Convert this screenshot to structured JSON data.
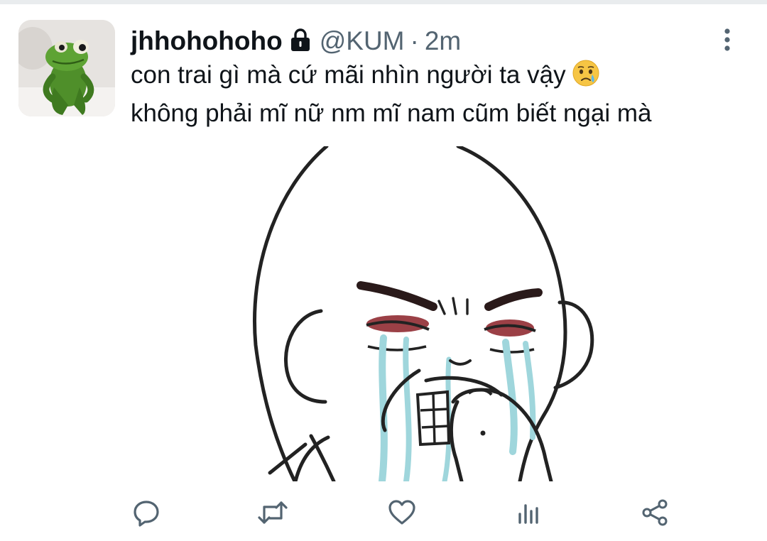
{
  "tweet": {
    "display_name": "jhhohohoho",
    "handle": "@KUM",
    "separator": "·",
    "timestamp": "2m",
    "protected_icon": "lock-icon",
    "text_line_1": "con trai gì mà cứ mãi nhìn người ta vậy",
    "text_line_1_emoji": "crying-face-emoji",
    "text_line_2": "không phải mĩ nữ nm mĩ nam cũm biết ngại mà",
    "avatar": "kermit-frog-avatar",
    "media": "crying-meme-face-image"
  },
  "actions": [
    {
      "icon": "reply-icon"
    },
    {
      "icon": "retweet-icon"
    },
    {
      "icon": "like-icon"
    },
    {
      "icon": "analytics-icon"
    },
    {
      "icon": "share-icon"
    }
  ],
  "colors": {
    "text": "#0f1419",
    "secondary": "#536471",
    "icon": "#536471",
    "tear": "#9fd6dc",
    "eye_red": "#8a1f26"
  }
}
